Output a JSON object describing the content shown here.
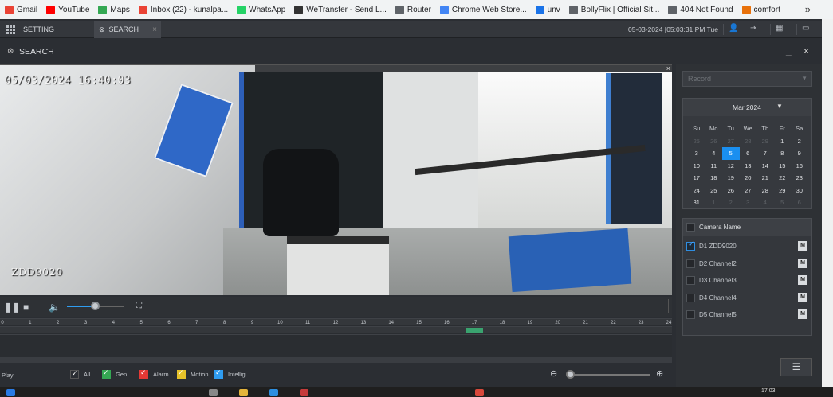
{
  "bookmarks": [
    {
      "label": "Gmail",
      "icon": "gmail-icon",
      "color": "#ea4335"
    },
    {
      "label": "YouTube",
      "icon": "youtube-icon",
      "color": "#ff0000"
    },
    {
      "label": "Maps",
      "icon": "maps-icon",
      "color": "#34a853"
    },
    {
      "label": "Inbox (22) - kunalpa...",
      "icon": "gmail-icon",
      "color": "#ea4335"
    },
    {
      "label": "WhatsApp",
      "icon": "whatsapp-icon",
      "color": "#25d366"
    },
    {
      "label": "WeTransfer - Send L...",
      "icon": "wetransfer-icon",
      "color": "#333333"
    },
    {
      "label": "Router",
      "icon": "globe-icon",
      "color": "#5f6368"
    },
    {
      "label": "Chrome Web Store...",
      "icon": "chrome-store-icon",
      "color": "#4285f4"
    },
    {
      "label": "unv",
      "icon": "unv-icon",
      "color": "#1a73e8"
    },
    {
      "label": "BollyFlix | Official Sit...",
      "icon": "globe-icon",
      "color": "#5f6368"
    },
    {
      "label": "404 Not Found",
      "icon": "page-icon",
      "color": "#5f6368"
    },
    {
      "label": "comfort",
      "icon": "comfort-icon",
      "color": "#e8710a"
    }
  ],
  "bookmarks_more": "»",
  "top": {
    "setting_tab": "SETTING",
    "search_tab": "SEARCH",
    "close": "×",
    "datetime": "05-03-2024 [05:03:31 PM Tue"
  },
  "search": {
    "title": "SEARCH",
    "controls": "_ ×"
  },
  "video": {
    "osd_time": "05/03/2024 16:40:03",
    "osd_name": "ZDD9020",
    "close": "×"
  },
  "timeline": {
    "ticks": [
      "0",
      "1",
      "2",
      "3",
      "4",
      "5",
      "6",
      "7",
      "8",
      "9",
      "10",
      "11",
      "12",
      "13",
      "14",
      "15",
      "16",
      "17",
      "18",
      "19",
      "20",
      "21",
      "22",
      "23",
      "24"
    ],
    "recording": {
      "start_hour": 16.7,
      "end_hour": 17.3
    },
    "rec_color": "#3aa36f"
  },
  "bottom": {
    "play": "Play",
    "filters": [
      {
        "label": "All",
        "color": "#2b2e33"
      },
      {
        "label": "Gen...",
        "color": "#34a853"
      },
      {
        "label": "Alarm",
        "color": "#e53935"
      },
      {
        "label": "Motion",
        "color": "#e6c229"
      },
      {
        "label": "Intellig...",
        "color": "#2f9cf0"
      }
    ]
  },
  "right": {
    "record_select": "Record",
    "calendar": {
      "month": "Mar 2024",
      "weekdays": [
        "Su",
        "Mo",
        "Tu",
        "We",
        "Th",
        "Fr",
        "Sa"
      ],
      "days": [
        {
          "d": "25",
          "dim": true
        },
        {
          "d": "26",
          "dim": true
        },
        {
          "d": "27",
          "dim": true
        },
        {
          "d": "28",
          "dim": true
        },
        {
          "d": "29",
          "dim": true
        },
        {
          "d": "1"
        },
        {
          "d": "2"
        },
        {
          "d": "3"
        },
        {
          "d": "4"
        },
        {
          "d": "5",
          "sel": true
        },
        {
          "d": "6"
        },
        {
          "d": "7"
        },
        {
          "d": "8"
        },
        {
          "d": "9"
        },
        {
          "d": "10"
        },
        {
          "d": "11"
        },
        {
          "d": "12"
        },
        {
          "d": "13"
        },
        {
          "d": "14"
        },
        {
          "d": "15"
        },
        {
          "d": "16"
        },
        {
          "d": "17"
        },
        {
          "d": "18"
        },
        {
          "d": "19"
        },
        {
          "d": "20"
        },
        {
          "d": "21"
        },
        {
          "d": "22"
        },
        {
          "d": "23"
        },
        {
          "d": "24"
        },
        {
          "d": "25"
        },
        {
          "d": "26"
        },
        {
          "d": "27"
        },
        {
          "d": "28"
        },
        {
          "d": "29"
        },
        {
          "d": "30"
        },
        {
          "d": "31"
        },
        {
          "d": "1",
          "dim": true
        },
        {
          "d": "2",
          "dim": true
        },
        {
          "d": "3",
          "dim": true
        },
        {
          "d": "4",
          "dim": true
        },
        {
          "d": "5",
          "dim": true
        },
        {
          "d": "6",
          "dim": true
        }
      ]
    },
    "camera_header": "Camera Name",
    "cameras": [
      {
        "name": "D1 ZDD9020",
        "checked": true,
        "badge": "M"
      },
      {
        "name": "D2 Channel2",
        "checked": false,
        "badge": "M"
      },
      {
        "name": "D3 Channel3",
        "checked": false,
        "badge": "M"
      },
      {
        "name": "D4 Channel4",
        "checked": false,
        "badge": "M"
      },
      {
        "name": "D5 Channel5",
        "checked": false,
        "badge": "M"
      }
    ]
  },
  "taskbar": {
    "time": "17:03"
  }
}
